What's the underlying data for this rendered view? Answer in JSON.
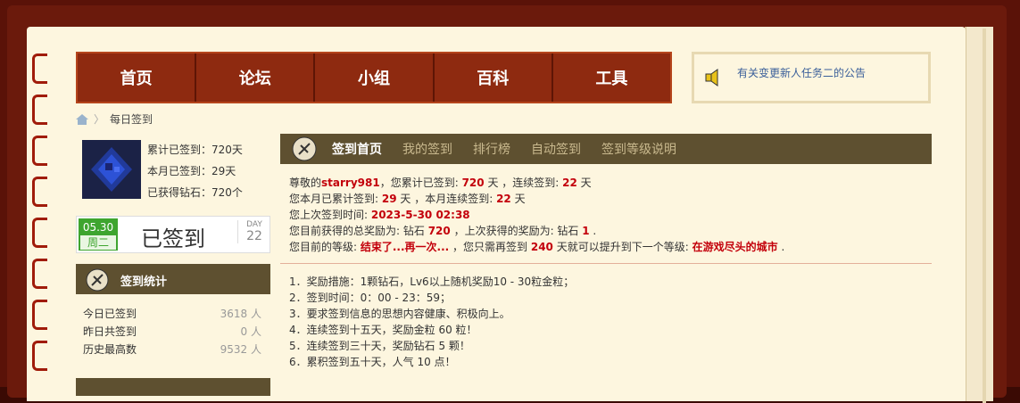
{
  "nav": {
    "items": [
      "首页",
      "论坛",
      "小组",
      "百科",
      "工具"
    ]
  },
  "notice": {
    "text": "有关变更新人任务二的公告"
  },
  "breadcrumb": {
    "current": "每日签到"
  },
  "user_stats": {
    "total": "累计已签到：720天",
    "month": "本月已签到：29天",
    "diamonds": "已获得钻石：720个"
  },
  "sign_status": {
    "date": "05.30",
    "weekday": "周二",
    "label": "已签到",
    "day_label": "DAY",
    "day_num": "22"
  },
  "sign_stats": {
    "title": "签到统计",
    "rows": [
      {
        "label": "今日已签到",
        "value": "3618 人"
      },
      {
        "label": "昨日共签到",
        "value": "0 人"
      },
      {
        "label": "历史最高数",
        "value": "9532 人"
      }
    ]
  },
  "tabs": [
    {
      "label": "签到首页",
      "active": true
    },
    {
      "label": "我的签到",
      "active": false
    },
    {
      "label": "排行榜",
      "active": false
    },
    {
      "label": "自动签到",
      "active": false
    },
    {
      "label": "签到等级说明",
      "active": false
    }
  ],
  "info": {
    "l1_a": "尊敬的",
    "username": "starry981",
    "l1_b": "，您累计已签到: ",
    "total_days": "720",
    "l1_c": " 天 ，连续签到: ",
    "streak": "22",
    "l1_d": " 天",
    "l2_a": "您本月已累计签到: ",
    "month_days": "29",
    "l2_b": " 天 ，本月连续签到: ",
    "month_streak": "22",
    "l2_c": " 天",
    "l3_a": "您上次签到时间: ",
    "last_time": "2023-5-30 02:38",
    "l4_a": "您目前获得的总奖励为: 钻石 ",
    "total_reward": "720",
    "l4_b": " ，上次获得的奖励为: 钻石 ",
    "last_reward": "1",
    "l4_c": " .",
    "l5_a": "您目前的等级: ",
    "level": "结束了...再一次...",
    "l5_b": " ，您只需再签到 ",
    "need_days": "240",
    "l5_c": " 天就可以提升到下一个等级: ",
    "next_level": "在游戏尽头的城市",
    "l5_d": " ."
  },
  "rules": [
    "1．奖励措施：1颗钻石，Lv6以上随机奖励10 - 30粒金粒；",
    "2．签到时间：0：00 - 23：59；",
    "3．要求签到信息的思想内容健康、积极向上。",
    "4．连续签到十五天，奖励金粒 60 粒！",
    "5．连续签到三十天，奖励钻石 5 颗！",
    "6．累积签到五十天，人气 10 点！"
  ]
}
